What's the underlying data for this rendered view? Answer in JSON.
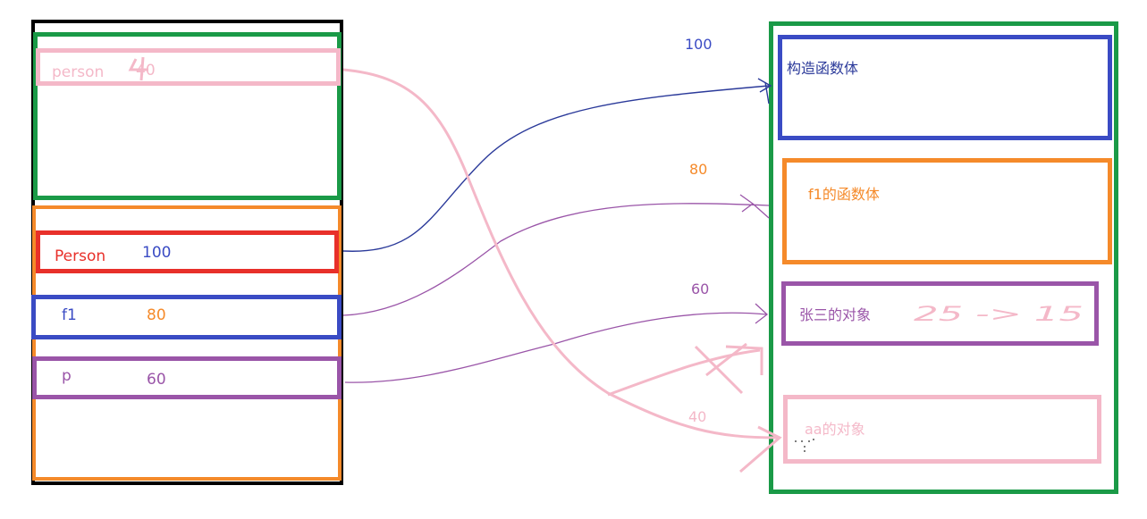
{
  "colors": {
    "black": "#000000",
    "green": "#1a9a47",
    "pink": "#f4b8c8",
    "orange": "#f58a2a",
    "red": "#e8302a",
    "blue": "#3a4bc4",
    "purple": "#9a55a8",
    "navy": "#2b3a9a"
  },
  "stack": {
    "person": {
      "name": "person",
      "value": "40"
    },
    "Person": {
      "name": "Person",
      "value": "100"
    },
    "f1": {
      "name": "f1",
      "value": "80"
    },
    "p": {
      "name": "p",
      "value": "60"
    }
  },
  "heap": {
    "constructor": {
      "address": "100",
      "label": "构造函数体"
    },
    "f1_body": {
      "address": "80",
      "label": "f1的函数体"
    },
    "zhangsan": {
      "address": "60",
      "label": "张三的对象",
      "handwritten": "25 -> 15"
    },
    "aa": {
      "address": "40",
      "label": "aa的对象"
    }
  }
}
